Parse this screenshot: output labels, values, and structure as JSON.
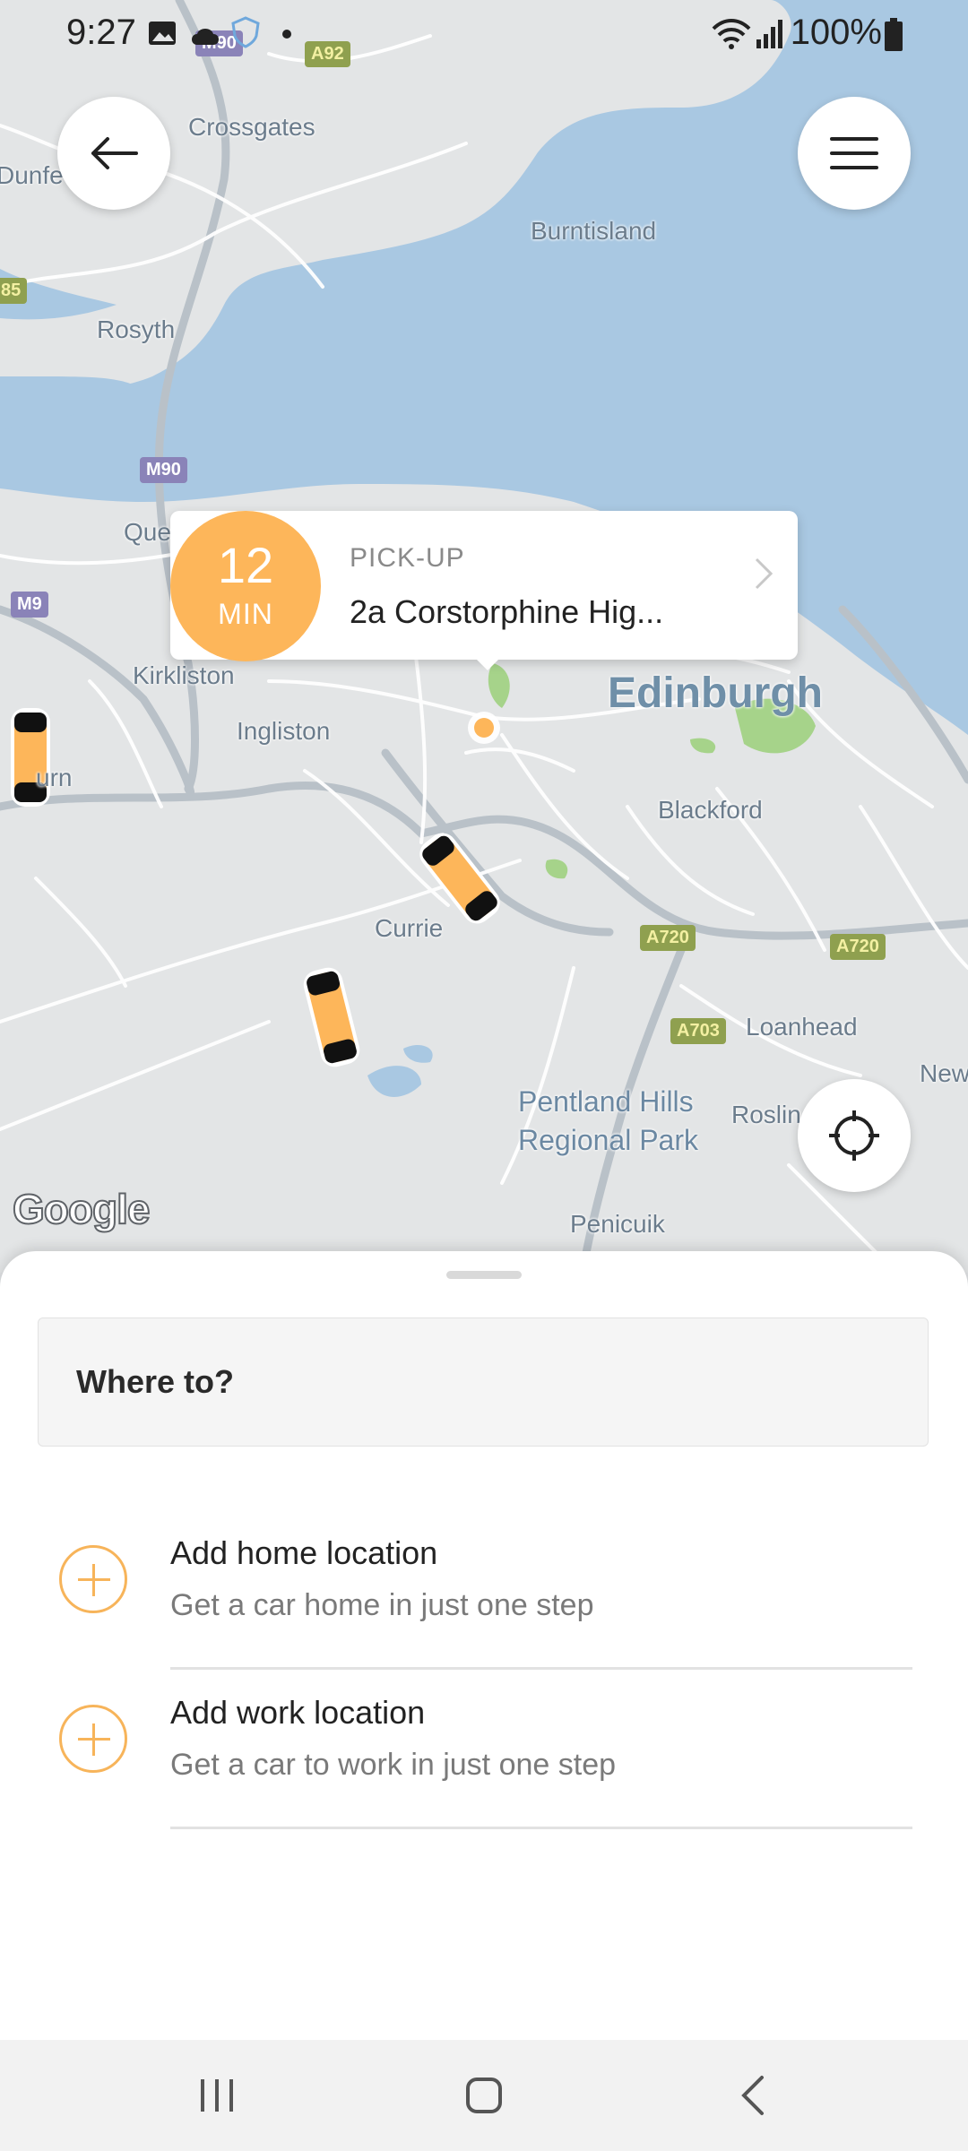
{
  "status_bar": {
    "time": "9:27",
    "battery": "100%"
  },
  "map": {
    "labels": {
      "crossgates": "Crossgates",
      "burntisland": "Burntisland",
      "rosyth": "Rosyth",
      "dunfermline_partial": "Dunfe",
      "queensferry_partial": "Queen",
      "kirkliston": "Kirkliston",
      "ingliston": "Ingliston",
      "edinburgh": "Edinburgh",
      "blackford": "Blackford",
      "currie": "Currie",
      "loanhead": "Loanhead",
      "pentland": "Pentland Hills\nRegional Park",
      "roslin": "Roslin",
      "penicuik": "Penicuik",
      "newhaven_partial": "New",
      "ratho_partial": "urn"
    },
    "road_shields": {
      "m90_top": "M90",
      "a92": "A92",
      "m90": "M90",
      "m9": "M9",
      "a720_1": "A720",
      "a720_2": "A720",
      "a703": "A703",
      "left_85": "85"
    },
    "attribution": "Google"
  },
  "pickup_card": {
    "eta_value": "12",
    "eta_unit": "MIN",
    "title": "PICK-UP",
    "address": "2a Corstorphine Hig..."
  },
  "sheet": {
    "search_placeholder": "Where to?",
    "locations": [
      {
        "title": "Add home location",
        "subtitle": "Get a car home in just one step"
      },
      {
        "title": "Add work location",
        "subtitle": "Get a car to work in just one step"
      }
    ]
  },
  "colors": {
    "accent": "#FDB65A",
    "water": "#A9C8E2",
    "land": "#E3E5E6"
  }
}
